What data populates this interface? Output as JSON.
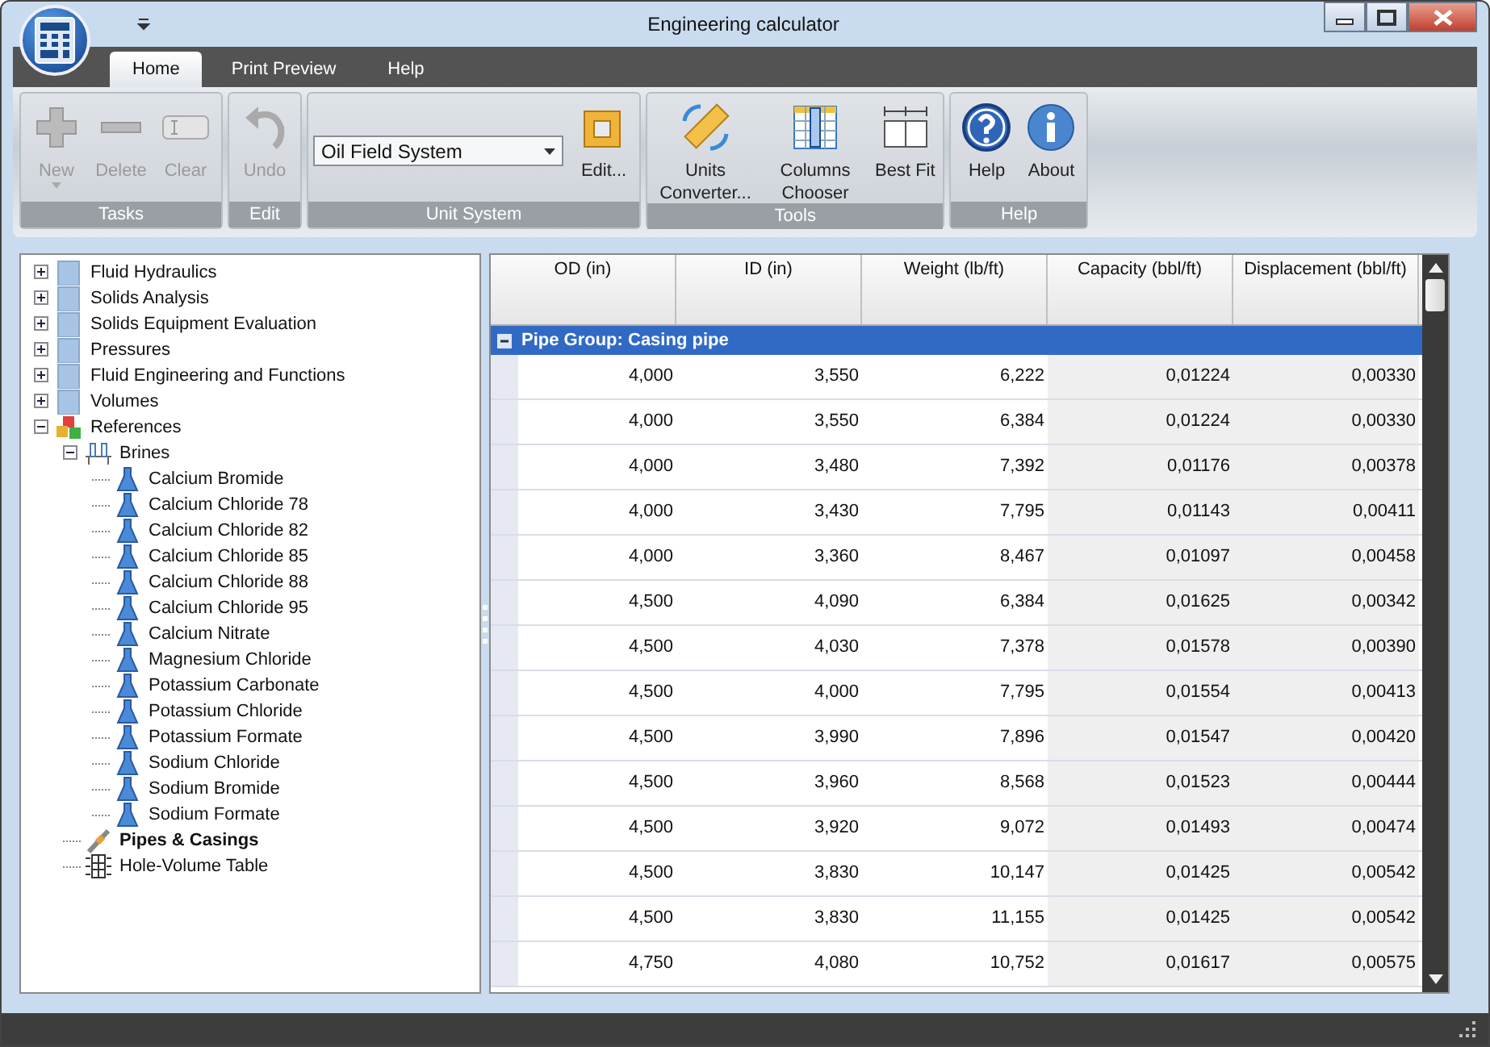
{
  "window": {
    "title": "Engineering calculator"
  },
  "tabs": [
    {
      "label": "Home",
      "selected": true
    },
    {
      "label": "Print Preview",
      "selected": false
    },
    {
      "label": "Help",
      "selected": false
    }
  ],
  "ribbon": [
    {
      "label": "Tasks",
      "items": [
        {
          "kind": "button",
          "label": "New",
          "disabled": true,
          "dropdown": true
        },
        {
          "kind": "button",
          "label": "Delete",
          "disabled": true
        },
        {
          "kind": "button",
          "label": "Clear",
          "disabled": true
        }
      ]
    },
    {
      "label": "Edit",
      "items": [
        {
          "kind": "button",
          "label": "Undo",
          "disabled": true
        }
      ]
    },
    {
      "label": "Unit System",
      "items": [
        {
          "kind": "combo",
          "value": "Oil Field System"
        },
        {
          "kind": "button",
          "label": "Edit...",
          "disabled": false
        }
      ]
    },
    {
      "label": "Tools",
      "items": [
        {
          "kind": "button",
          "label": "Units Converter...",
          "disabled": false
        },
        {
          "kind": "button",
          "label": "Columns Chooser",
          "disabled": false
        },
        {
          "kind": "button",
          "label": "Best Fit",
          "disabled": false
        }
      ]
    },
    {
      "label": "Help",
      "items": [
        {
          "kind": "button",
          "label": "Help",
          "disabled": false
        },
        {
          "kind": "button",
          "label": "About",
          "disabled": false
        }
      ]
    }
  ],
  "tree": [
    {
      "label": "Fluid Hydraulics",
      "kind": "folder",
      "expanded": false,
      "selected": false
    },
    {
      "label": "Solids Analysis",
      "kind": "folder",
      "expanded": false,
      "selected": false
    },
    {
      "label": "Solids Equipment Evaluation",
      "kind": "folder",
      "expanded": false,
      "selected": false
    },
    {
      "label": "Pressures",
      "kind": "folder",
      "expanded": false,
      "selected": false
    },
    {
      "label": "Fluid Engineering and Functions",
      "kind": "folder",
      "expanded": false,
      "selected": false
    },
    {
      "label": "Volumes",
      "kind": "folder",
      "expanded": false,
      "selected": false
    },
    {
      "label": "References",
      "kind": "blocks",
      "expanded": true,
      "selected": false,
      "children": [
        {
          "label": "Brines",
          "kind": "rack",
          "expanded": true,
          "selected": false,
          "children": [
            {
              "label": "Calcium Bromide",
              "kind": "flask",
              "selected": false
            },
            {
              "label": "Calcium Chloride 78",
              "kind": "flask",
              "selected": false
            },
            {
              "label": "Calcium Chloride 82",
              "kind": "flask",
              "selected": false
            },
            {
              "label": "Calcium Chloride 85",
              "kind": "flask",
              "selected": false
            },
            {
              "label": "Calcium Chloride 88",
              "kind": "flask",
              "selected": false
            },
            {
              "label": "Calcium Chloride 95",
              "kind": "flask",
              "selected": false
            },
            {
              "label": "Calcium Nitrate",
              "kind": "flask",
              "selected": false
            },
            {
              "label": "Magnesium Chloride",
              "kind": "flask",
              "selected": false
            },
            {
              "label": "Potassium Carbonate",
              "kind": "flask",
              "selected": false
            },
            {
              "label": "Potassium Chloride",
              "kind": "flask",
              "selected": false
            },
            {
              "label": "Potassium Formate",
              "kind": "flask",
              "selected": false
            },
            {
              "label": "Sodium Chloride",
              "kind": "flask",
              "selected": false
            },
            {
              "label": "Sodium Bromide",
              "kind": "flask",
              "selected": false
            },
            {
              "label": "Sodium Formate",
              "kind": "flask",
              "selected": false
            }
          ]
        },
        {
          "label": "Pipes & Casings",
          "kind": "pipe",
          "selected": true
        },
        {
          "label": "Hole-Volume Table",
          "kind": "table",
          "selected": false
        }
      ]
    }
  ],
  "table": {
    "columns": [
      {
        "label": "OD (in)",
        "readonly": false
      },
      {
        "label": "ID (in)",
        "readonly": false
      },
      {
        "label": "Weight (lb/ft)",
        "readonly": false
      },
      {
        "label": "Capacity (bbl/ft)",
        "readonly": true
      },
      {
        "label": "Displacement (bbl/ft)",
        "readonly": true
      }
    ],
    "group": {
      "label": "Pipe Group: Casing pipe",
      "expanded": true
    },
    "rows": [
      [
        "4,000",
        "3,550",
        "6,222",
        "0,01224",
        "0,00330"
      ],
      [
        "4,000",
        "3,550",
        "6,384",
        "0,01224",
        "0,00330"
      ],
      [
        "4,000",
        "3,480",
        "7,392",
        "0,01176",
        "0,00378"
      ],
      [
        "4,000",
        "3,430",
        "7,795",
        "0,01143",
        "0,00411"
      ],
      [
        "4,000",
        "3,360",
        "8,467",
        "0,01097",
        "0,00458"
      ],
      [
        "4,500",
        "4,090",
        "6,384",
        "0,01625",
        "0,00342"
      ],
      [
        "4,500",
        "4,030",
        "7,378",
        "0,01578",
        "0,00390"
      ],
      [
        "4,500",
        "4,000",
        "7,795",
        "0,01554",
        "0,00413"
      ],
      [
        "4,500",
        "3,990",
        "7,896",
        "0,01547",
        "0,00420"
      ],
      [
        "4,500",
        "3,960",
        "8,568",
        "0,01523",
        "0,00444"
      ],
      [
        "4,500",
        "3,920",
        "9,072",
        "0,01493",
        "0,00474"
      ],
      [
        "4,500",
        "3,830",
        "10,147",
        "0,01425",
        "0,00542"
      ],
      [
        "4,500",
        "3,830",
        "11,155",
        "0,01425",
        "0,00542"
      ],
      [
        "4,750",
        "4,080",
        "10,752",
        "0,01617",
        "0,00575"
      ]
    ]
  }
}
